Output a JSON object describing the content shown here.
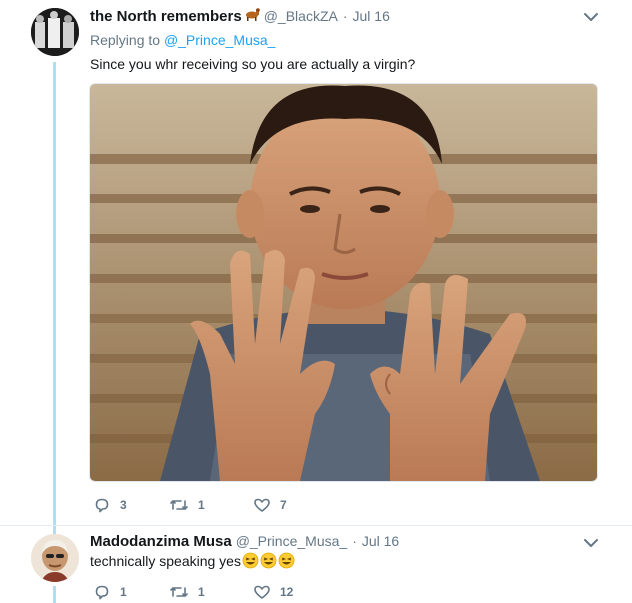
{
  "tweet1": {
    "author_name": "the North remembers",
    "author_emoji": "horse-emoji",
    "handle": "@_BlackZA",
    "separator": "·",
    "time": "Jul 16",
    "replying_prefix": "Replying to",
    "replying_handle": "@_Prince_Musa_",
    "text": "Since you whr receiving so you are actually a virgin?",
    "media_description_icon": "photo",
    "reply_count": "3",
    "retweet_count": "1",
    "like_count": "7"
  },
  "tweet2": {
    "author_name": "Madodanzima Musa",
    "handle": "@_Prince_Musa_",
    "separator": "·",
    "time": "Jul 16",
    "text": "technically speaking yes",
    "text_emoji": [
      "laughing-emoji",
      "laughing-emoji",
      "laughing-emoji"
    ],
    "reply_count": "1",
    "retweet_count": "1",
    "like_count": "12"
  },
  "colors": {
    "link": "#1da1f2",
    "muted": "#657786",
    "thread": "#b2dcf2",
    "text": "#14171a"
  }
}
